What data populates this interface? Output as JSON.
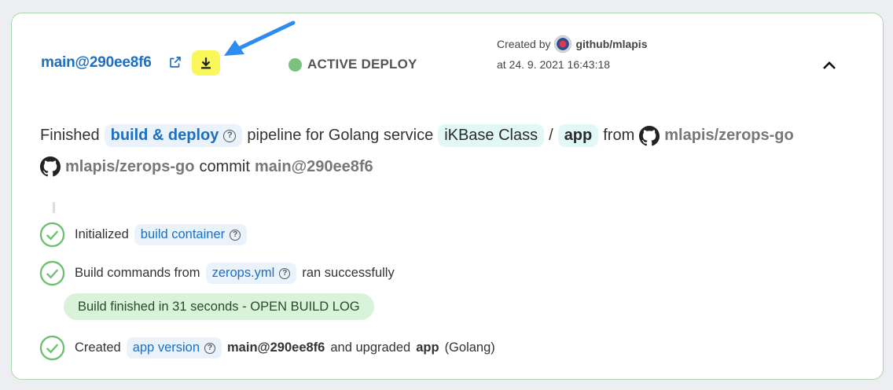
{
  "header": {
    "commit_ref": "main@290ee8f6",
    "status": "ACTIVE DEPLOY",
    "created_by_label": "Created by",
    "created_by_user": "github/mlapis",
    "created_at_prefix": "at",
    "created_at": "24. 9. 2021 16:43:18"
  },
  "summary": {
    "finished": "Finished",
    "pipeline_chip": "build & deploy",
    "pipeline_text": "pipeline for Golang service",
    "project": "iKBase Class",
    "slash": "/",
    "service": "app",
    "from": "from",
    "repo": "mlapis/zerops-go",
    "repo2": "mlapis/zerops-go",
    "commit_word": "commit",
    "commit_ref": "main@290ee8f6"
  },
  "steps": [
    {
      "prefix": "Initialized",
      "chip": "build container",
      "suffix": ""
    },
    {
      "prefix": "Build commands from",
      "chip": "zerops.yml",
      "suffix": "ran successfully"
    },
    {
      "prefix": "Created",
      "chip": "app version",
      "version_ref": "main@290ee8f6",
      "mid": "and upgraded",
      "service": "app",
      "suffix": "(Golang)"
    }
  ],
  "build_log": {
    "text": "Build finished in 31 seconds",
    "action": "- OPEN BUILD LOG"
  },
  "colors": {
    "link": "#1b6fc4",
    "status_dot": "#7cc07f",
    "highlight": "#f9f75a",
    "arrow": "#2e8cf0",
    "success": "#6cc070"
  },
  "icons": [
    "external-link-icon",
    "download-icon",
    "annotation-arrow",
    "chevron-up-icon",
    "help-icon",
    "github-icon",
    "check-circle-icon"
  ]
}
